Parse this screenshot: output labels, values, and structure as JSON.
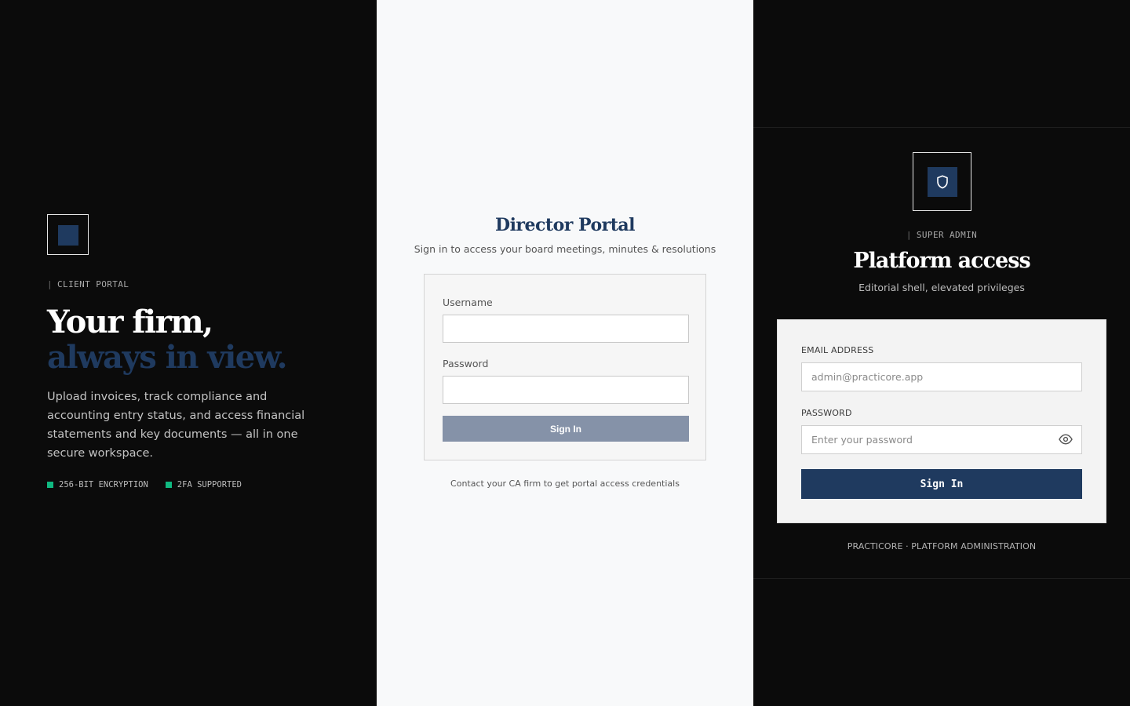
{
  "client_portal": {
    "eyebrow": "CLIENT PORTAL",
    "title_line1": "Your firm,",
    "title_line2": "always in view.",
    "description": "Upload invoices, track compliance and accounting entry status, and access financial statements and key documents — all in one secure workspace.",
    "badges": [
      "256-BIT ENCRYPTION",
      "2FA SUPPORTED"
    ],
    "logo_icon": "square-logo-icon"
  },
  "director_portal": {
    "title": "Director Portal",
    "subtitle": "Sign in to access your board meetings, minutes & resolutions",
    "username_label": "Username",
    "username_value": "",
    "password_label": "Password",
    "password_value": "",
    "signin_label": "Sign In",
    "footer": "Contact your CA firm to get portal access credentials"
  },
  "super_admin": {
    "eyebrow": "SUPER ADMIN",
    "title": "Platform access",
    "subtitle": "Editorial shell, elevated privileges",
    "email_label": "EMAIL ADDRESS",
    "email_placeholder": "admin@practicore.app",
    "password_label": "PASSWORD",
    "password_placeholder": "Enter your password",
    "signin_label": "Sign In",
    "footer": "PRACTICORE · PLATFORM ADMINISTRATION",
    "logo_icon": "shield-icon",
    "toggle_icon": "eye-icon"
  },
  "colors": {
    "navy": "#1f3a5f",
    "muted_button": "#8592a8",
    "badge_green": "#10b981",
    "dark_bg": "#0b0b0b",
    "light_bg": "#f8f9fa"
  }
}
